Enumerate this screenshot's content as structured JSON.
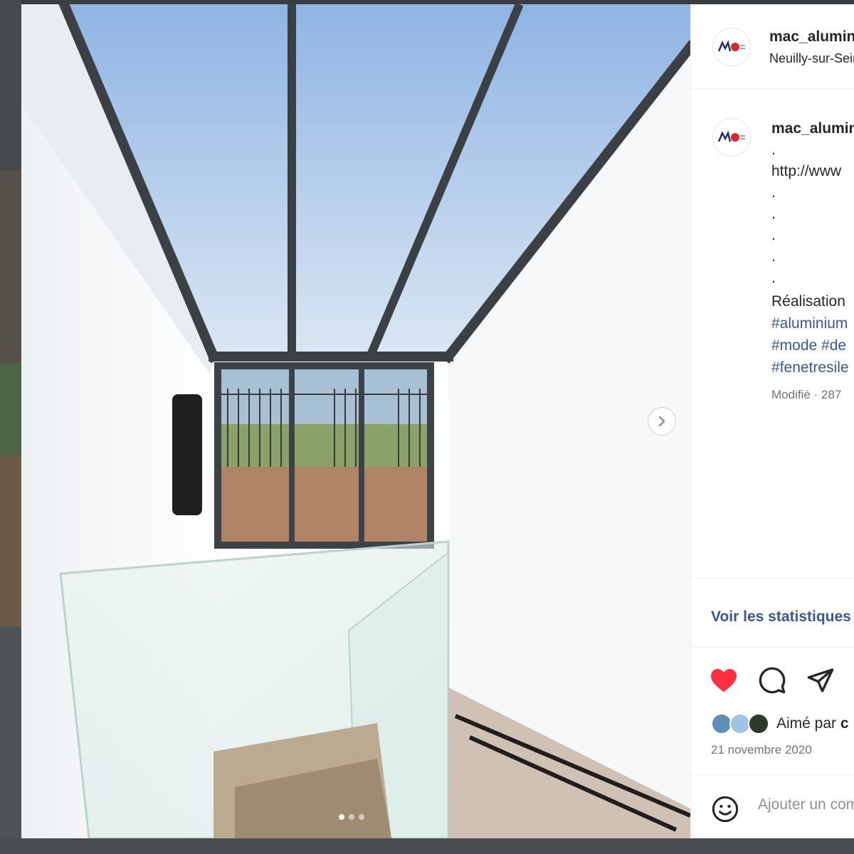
{
  "post": {
    "username": "mac_aluminium",
    "location": "Neuilly-sur-Seine",
    "caption": {
      "username": "mac_aluminium",
      "lines": [
        ".",
        "http://www",
        ".",
        ".",
        ".",
        ".",
        "."
      ],
      "text": "Réalisation",
      "hashtags_1": "#aluminium",
      "hashtags_2": "#mode #de",
      "hashtags_3": "#fenetresile"
    },
    "edited_meta": "Modifié · 287",
    "stats_link": "Voir les statistiques",
    "liked_by_prefix": "Aimé par",
    "liked_by_user": "c",
    "date": "21 novembre 2020",
    "comment_placeholder": "Ajouter un commentaire..."
  },
  "carousel": {
    "current_index": 1,
    "total": 3
  },
  "icons": {
    "like": "heart-filled-icon",
    "comment": "comment-bubble-icon",
    "share": "paper-plane-icon",
    "next": "chevron-right-icon",
    "emoji": "smiley-icon"
  },
  "colors": {
    "like_red": "#ff3040",
    "link_blue": "#385898",
    "text": "#262626",
    "muted": "#737373",
    "divider": "#efefef"
  }
}
